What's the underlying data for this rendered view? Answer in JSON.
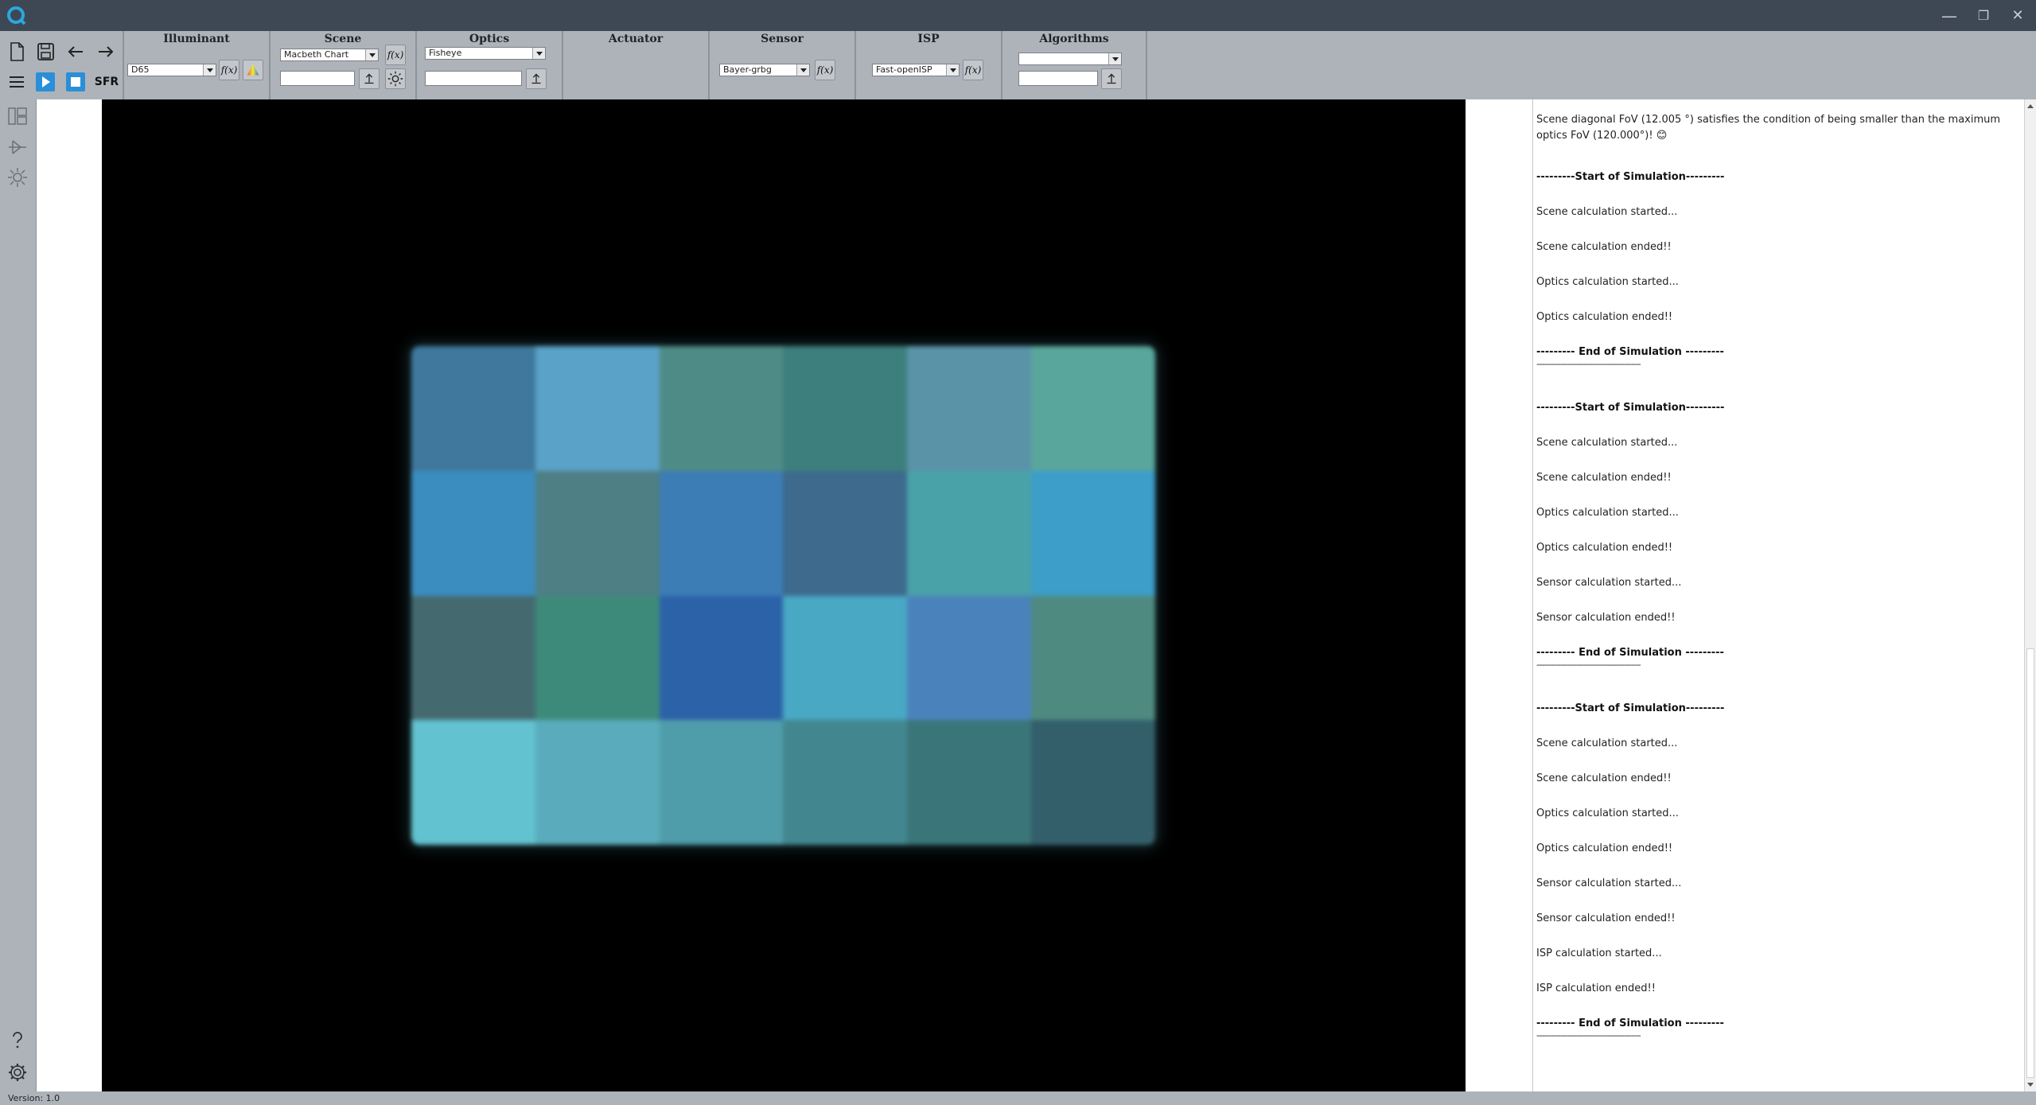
{
  "titlebar": {
    "logo_icon": "app-logo-icon",
    "minimize": "—",
    "restore": "❐",
    "close": "✕"
  },
  "toolbar": {
    "sfr_label": "SFR"
  },
  "groups": {
    "illuminant": {
      "title": "Illuminant",
      "selected": "D65"
    },
    "scene": {
      "title": "Scene",
      "selected": "Macbeth Chart",
      "input": ""
    },
    "optics": {
      "title": "Optics",
      "selected": "Fisheye",
      "input": ""
    },
    "actuator": {
      "title": "Actuator"
    },
    "sensor": {
      "title": "Sensor",
      "selected": "Bayer-grbg"
    },
    "isp": {
      "title": "ISP",
      "selected": "Fast-openISP"
    },
    "algorithms": {
      "title": "Algorithms",
      "selected": "",
      "input": ""
    }
  },
  "fx_label": "f(x)",
  "chart_colors": [
    "#3f789c",
    "#5aa2c8",
    "#4f8b86",
    "#3d7f7d",
    "#5a93a8",
    "#59a69c",
    "#3b8dc0",
    "#4e7f84",
    "#3c7db6",
    "#3d6a8d",
    "#48a2a8",
    "#3c9ec9",
    "#446a70",
    "#3e8a7a",
    "#2c62a8",
    "#49a8c4",
    "#4a83bc",
    "#4f8a80",
    "#62c2d0",
    "#5aacbc",
    "#4f9daa",
    "#428790",
    "#3a7679",
    "#335f6b"
  ],
  "log": {
    "intro": "Scene diagonal FoV (12.005 °) satisfies the condition of being smaller than the maximum optics FoV (120.000°)! 😊",
    "start": "---------Start of Simulation---------",
    "end": "--------- End of Simulation ---------",
    "end_rule": "--------------------------------------------",
    "scene_started": "Scene calculation started...",
    "scene_ended": "Scene calculation ended!!",
    "optics_started": "Optics calculation started...",
    "optics_ended": "Optics calculation ended!!",
    "sensor_started": "Sensor calculation started...",
    "sensor_ended": "Sensor calculation ended!!",
    "isp_started": "ISP calculation started...",
    "isp_ended": "ISP calculation ended!!"
  },
  "status": {
    "version": "Version: 1.0"
  }
}
